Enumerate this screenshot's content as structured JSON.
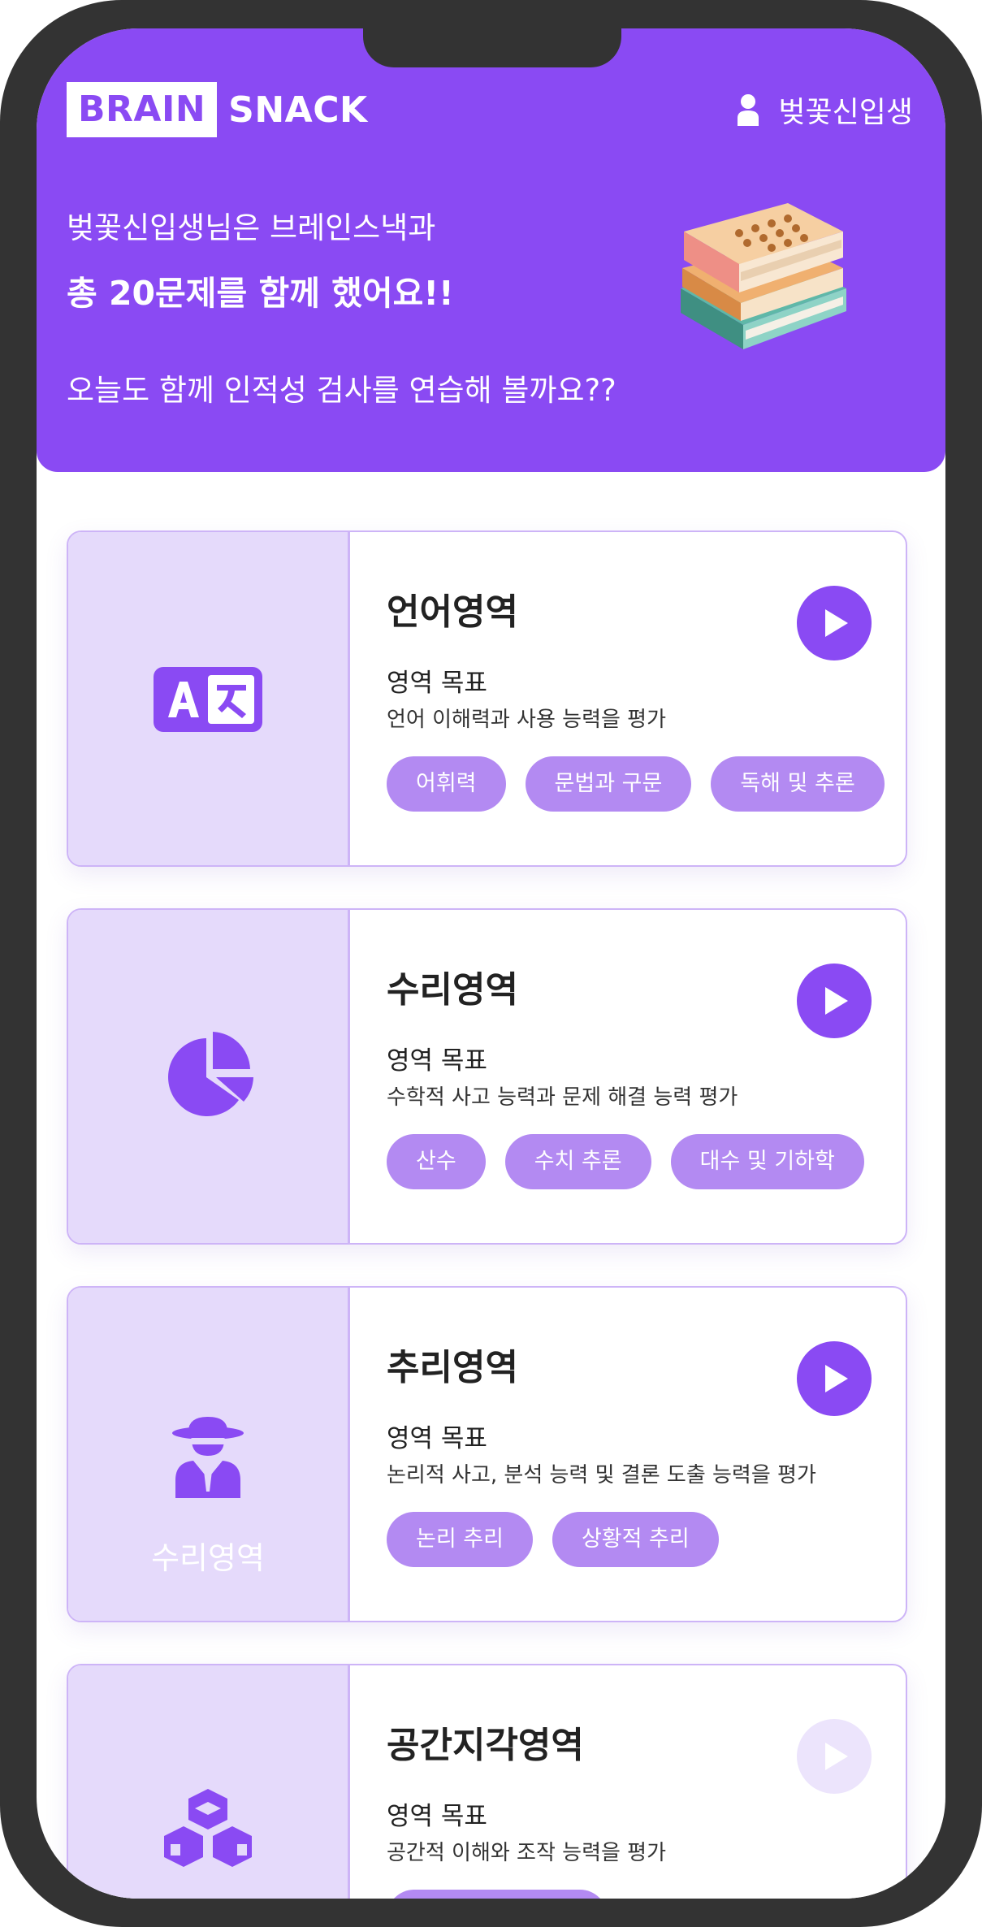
{
  "header": {
    "logo_brain": "BRAIN",
    "logo_snack": "SNACK",
    "username": "벚꽃신입생",
    "greeting_line1": "벚꽃신입생님은 브레인스낵과",
    "greeting_line2": "총 20문제를 함께 했어요!!",
    "greeting_line3": "오늘도 함께 인적성 검사를 연습해 볼까요??"
  },
  "colors": {
    "brand": "#8a4af3",
    "card_left_bg": "#e5dafb",
    "tag_bg": "#b38af2",
    "card_border": "#cdb4f7"
  },
  "cards": [
    {
      "icon": "translate-icon",
      "title": "언어영역",
      "goal_label": "영역 목표",
      "goal_desc": "언어 이해력과 사용 능력을 평가",
      "tags": [
        "어휘력",
        "문법과 구문",
        "독해 및 추론"
      ],
      "play_enabled": true
    },
    {
      "icon": "pie-chart-icon",
      "title": "수리영역",
      "goal_label": "영역 목표",
      "goal_desc": "수학적 사고 능력과 문제 해결 능력 평가",
      "tags": [
        "산수",
        "수치 추론",
        "대수 및 기하학"
      ],
      "play_enabled": true
    },
    {
      "icon": "detective-icon",
      "icon_caption": "수리영역",
      "title": "추리영역",
      "goal_label": "영역 목표",
      "goal_desc": "논리적 사고, 분석 능력 및 결론 도출 능력을 평가",
      "tags": [
        "논리 추리",
        "상황적 추리"
      ],
      "play_enabled": true
    },
    {
      "icon": "cubes-icon",
      "title": "공간지각영역",
      "goal_label": "영역 목표",
      "goal_desc": "공간적 이해와 조작 능력을 평가",
      "tags": [
        ""
      ],
      "play_enabled": false
    }
  ]
}
